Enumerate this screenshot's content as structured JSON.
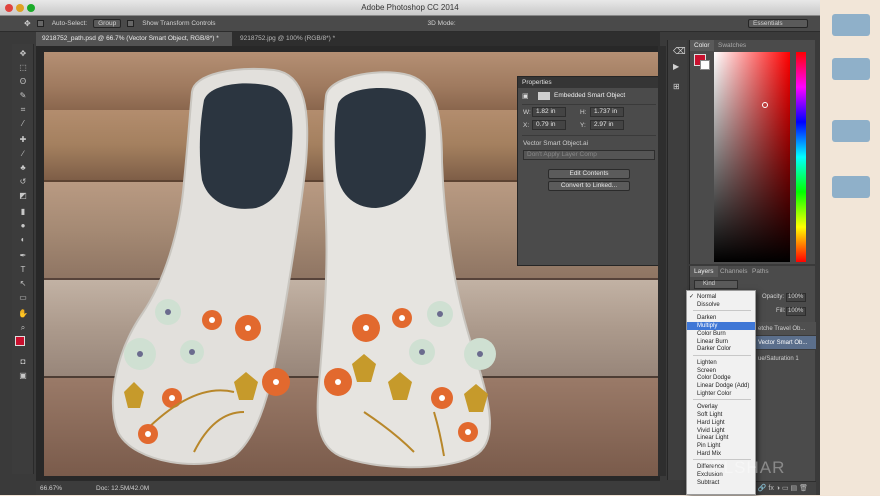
{
  "window": {
    "title": "Adobe Photoshop CC 2014"
  },
  "options_bar": {
    "auto_select_label": "Auto-Select:",
    "auto_select_value": "Group",
    "show_transform_label": "Show Transform Controls",
    "mode_3d": "3D Mode:",
    "workspace": "Essentials"
  },
  "tabs": [
    {
      "label": "9218752_path.psd @ 66.7% (Vector Smart Object, RGB/8*) *"
    },
    {
      "label": "9218752.jpg @ 100% (RGB/8*) *"
    }
  ],
  "properties": {
    "title": "Properties",
    "type_label": "Embedded Smart Object",
    "w_label": "W:",
    "w_value": "1.82 in",
    "h_label": "H:",
    "h_value": "1.737 in",
    "x_label": "X:",
    "x_value": "0.79 in",
    "y_label": "Y:",
    "y_value": "2.97 in",
    "source": "Vector Smart Object.ai",
    "layer_comp": "Don't Apply Layer Comp",
    "edit_btn": "Edit Contents",
    "convert_btn": "Convert to Linked..."
  },
  "color_panel": {
    "tab_color": "Color",
    "tab_swatches": "Swatches",
    "foreground": "#c8102e",
    "background": "#ffffff"
  },
  "layers_panel": {
    "tab_layers": "Layers",
    "tab_channels": "Channels",
    "tab_paths": "Paths",
    "kind": "Kind",
    "opacity_label": "Opacity:",
    "opacity_value": "100%",
    "fill_label": "Fill:",
    "fill_value": "100%",
    "rows": [
      "etche Travel Ob...",
      "Vector Smart Ob...",
      "ue/Saturation 1"
    ]
  },
  "blend_menu": {
    "selected": "Normal",
    "highlighted": "Multiply",
    "groups": [
      [
        "Normal",
        "Dissolve"
      ],
      [
        "Darken",
        "Multiply",
        "Color Burn",
        "Linear Burn",
        "Darker Color"
      ],
      [
        "Lighten",
        "Screen",
        "Color Dodge",
        "Linear Dodge (Add)",
        "Lighter Color"
      ],
      [
        "Overlay",
        "Soft Light",
        "Hard Light",
        "Vivid Light",
        "Linear Light",
        "Pin Light",
        "Hard Mix"
      ],
      [
        "Difference",
        "Exclusion",
        "Subtract"
      ]
    ]
  },
  "status": {
    "zoom": "66.67%",
    "doc": "Doc: 12.5M/42.0M"
  },
  "watermark": "TELSHAR"
}
